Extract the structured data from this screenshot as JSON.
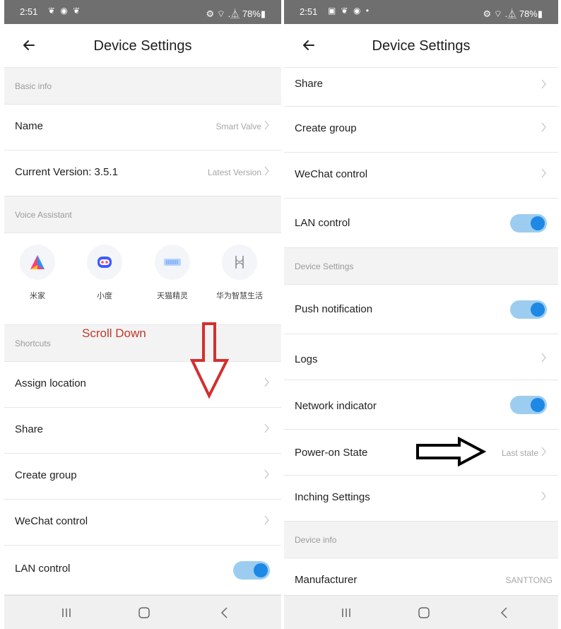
{
  "left": {
    "status": {
      "time": "2:51",
      "notifications": "❦ ◉ ❦",
      "system": "⚙ ⌔ .⏅ 78%▮"
    },
    "title": "Device Settings",
    "basic_info": {
      "header": "Basic info",
      "name_label": "Name",
      "name_value": "Smart Valve",
      "version_label": "Current Version:  3.5.1",
      "version_value": "Latest Version"
    },
    "voice": {
      "header": "Voice Assistant",
      "items": [
        "米家",
        "小度",
        "天猫精灵",
        "华为智慧生活"
      ]
    },
    "shortcuts": {
      "header": "Shortcuts",
      "assign_location": "Assign location",
      "share": "Share",
      "create_group": "Create group",
      "wechat": "WeChat control",
      "lan": "LAN control"
    },
    "annotation": "Scroll Down"
  },
  "right": {
    "status": {
      "time": "2:51",
      "notifications": "▣ ❦ ◉ •",
      "system": "⚙ ⌔ .⏅ 78%▮"
    },
    "title": "Device Settings",
    "rows": {
      "share": "Share",
      "create_group": "Create group",
      "wechat": "WeChat control",
      "lan": "LAN control"
    },
    "device_settings": {
      "header": "Device Settings",
      "push": "Push notification",
      "logs": "Logs",
      "network": "Network indicator",
      "power_on": "Power-on State",
      "power_on_value": "Last state",
      "inching": "Inching Settings"
    },
    "device_info": {
      "header": "Device info",
      "manufacturer": "Manufacturer",
      "manufacturer_value": "SANTTONG"
    }
  },
  "toggles": {
    "left_lan": true,
    "right_lan": true,
    "push": true,
    "network": true
  },
  "colors": {
    "toggle_on": "#1e88e5",
    "toggle_track": "#9ccdf0",
    "annotation_red": "#c0392b"
  }
}
